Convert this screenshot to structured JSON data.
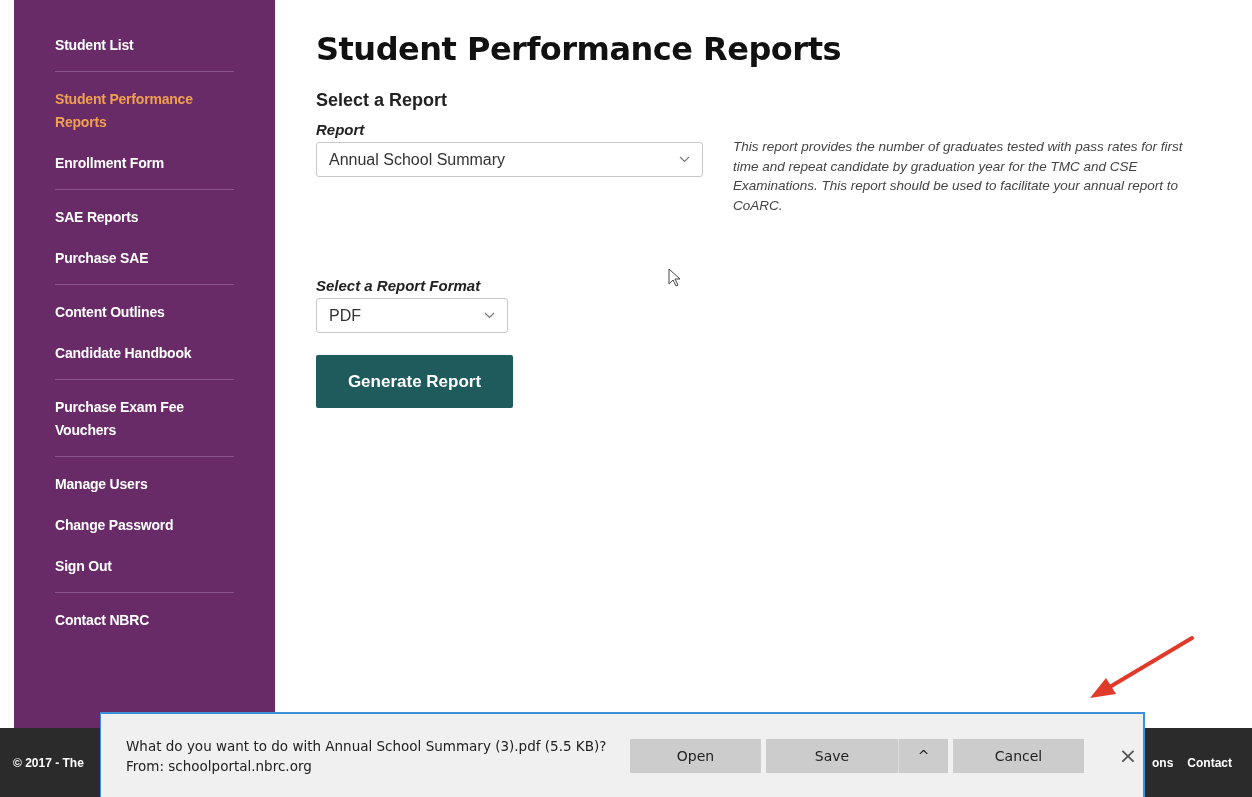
{
  "sidebar": {
    "groups": [
      {
        "items": [
          {
            "label": "Student List",
            "selected": false
          }
        ]
      },
      {
        "items": [
          {
            "label": "Student Performance Reports",
            "selected": true
          },
          {
            "label": "Enrollment Form",
            "selected": false
          }
        ]
      },
      {
        "items": [
          {
            "label": "SAE Reports",
            "selected": false
          },
          {
            "label": "Purchase SAE",
            "selected": false
          }
        ]
      },
      {
        "items": [
          {
            "label": "Content Outlines",
            "selected": false
          },
          {
            "label": "Candidate Handbook",
            "selected": false
          }
        ]
      },
      {
        "items": [
          {
            "label": "Purchase Exam Fee Vouchers",
            "selected": false
          }
        ]
      },
      {
        "items": [
          {
            "label": "Manage Users",
            "selected": false
          },
          {
            "label": "Change Password",
            "selected": false
          },
          {
            "label": "Sign Out",
            "selected": false
          }
        ]
      },
      {
        "items": [
          {
            "label": "Contact NBRC",
            "selected": false
          }
        ]
      }
    ]
  },
  "main": {
    "title": "Student Performance Reports",
    "section_title": "Select a Report",
    "report_field": {
      "label": "Report",
      "value": "Annual School Summary"
    },
    "description": "This report provides the number of graduates tested with pass rates for first time and repeat candidate by graduation year for the TMC and CSE Examinations. This report should be used to facilitate your annual report to CoARC.",
    "format_field": {
      "label": "Select a Report Format",
      "value": "PDF"
    },
    "generate_button": "Generate Report"
  },
  "footer": {
    "copyright": "© 2017 - The",
    "links": [
      "ons",
      "Contact"
    ]
  },
  "download_bar": {
    "message": "What do you want to do with Annual School Summary (3).pdf (5.5 KB)?",
    "source": "From: schoolportal.nbrc.org",
    "buttons": [
      "Open",
      "Save",
      "Cancel"
    ],
    "menu_caret": "^",
    "close": "×"
  }
}
